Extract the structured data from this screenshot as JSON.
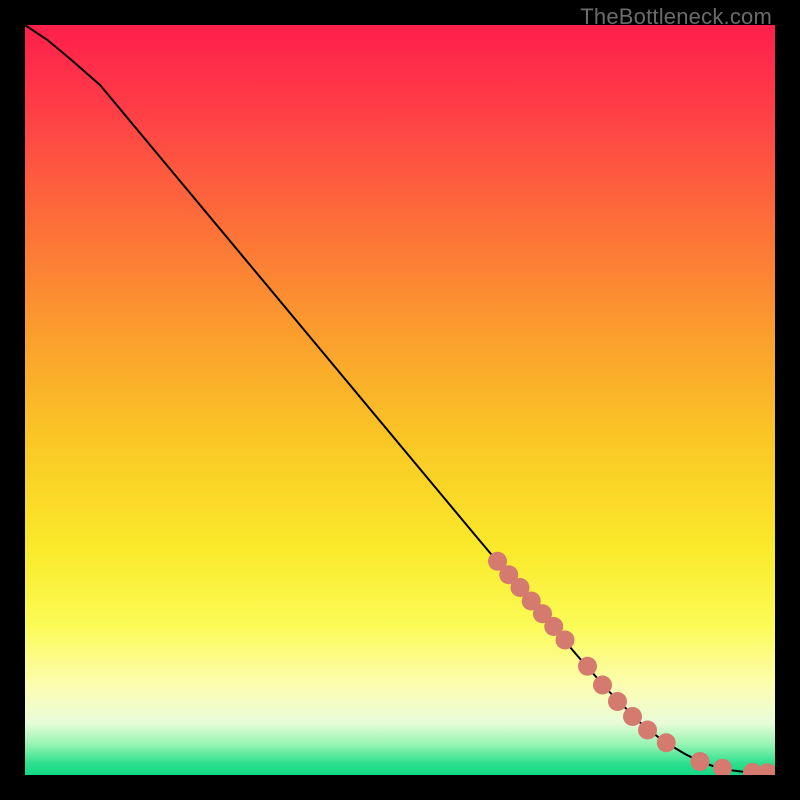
{
  "watermark": "TheBottleneck.com",
  "colors": {
    "gradient_stops": [
      {
        "offset": 0.0,
        "color": "#ff1f4b"
      },
      {
        "offset": 0.1,
        "color": "#ff3a48"
      },
      {
        "offset": 0.25,
        "color": "#fd6a3a"
      },
      {
        "offset": 0.4,
        "color": "#fb9a2e"
      },
      {
        "offset": 0.55,
        "color": "#fac625"
      },
      {
        "offset": 0.7,
        "color": "#faea2a"
      },
      {
        "offset": 0.8,
        "color": "#fbfb56"
      },
      {
        "offset": 0.88,
        "color": "#fdfdb0"
      },
      {
        "offset": 0.93,
        "color": "#e9fcd8"
      },
      {
        "offset": 0.96,
        "color": "#94f4b2"
      },
      {
        "offset": 0.985,
        "color": "#2be08e"
      },
      {
        "offset": 1.0,
        "color": "#12d985"
      }
    ],
    "curve": "#000000",
    "marker_fill": "#d47a6e",
    "marker_stroke": "#bb5f54"
  },
  "chart_data": {
    "type": "line",
    "title": "",
    "xlabel": "",
    "ylabel": "",
    "xlim": [
      0,
      100
    ],
    "ylim": [
      0,
      100
    ],
    "series": [
      {
        "name": "curve",
        "x": [
          0,
          3,
          6,
          10,
          15,
          20,
          30,
          40,
          50,
          60,
          68,
          74,
          78,
          82,
          85,
          88,
          90,
          92,
          94,
          96,
          98,
          100
        ],
        "y": [
          100,
          98,
          95.5,
          92,
          86,
          80,
          68,
          56,
          44,
          32,
          22.5,
          15.5,
          11,
          7,
          4.6,
          2.8,
          1.8,
          1.1,
          0.65,
          0.4,
          0.3,
          0.25
        ]
      }
    ],
    "markers": {
      "name": "highlighted-points",
      "x": [
        63,
        64.5,
        66,
        67.5,
        69,
        70.5,
        72,
        75,
        77,
        79,
        81,
        83,
        85.5,
        90,
        93,
        97,
        99
      ],
      "y": [
        28.5,
        26.7,
        25,
        23.2,
        21.5,
        19.8,
        18,
        14.5,
        12,
        9.8,
        7.8,
        6,
        4.3,
        1.8,
        0.9,
        0.35,
        0.3
      ]
    }
  }
}
